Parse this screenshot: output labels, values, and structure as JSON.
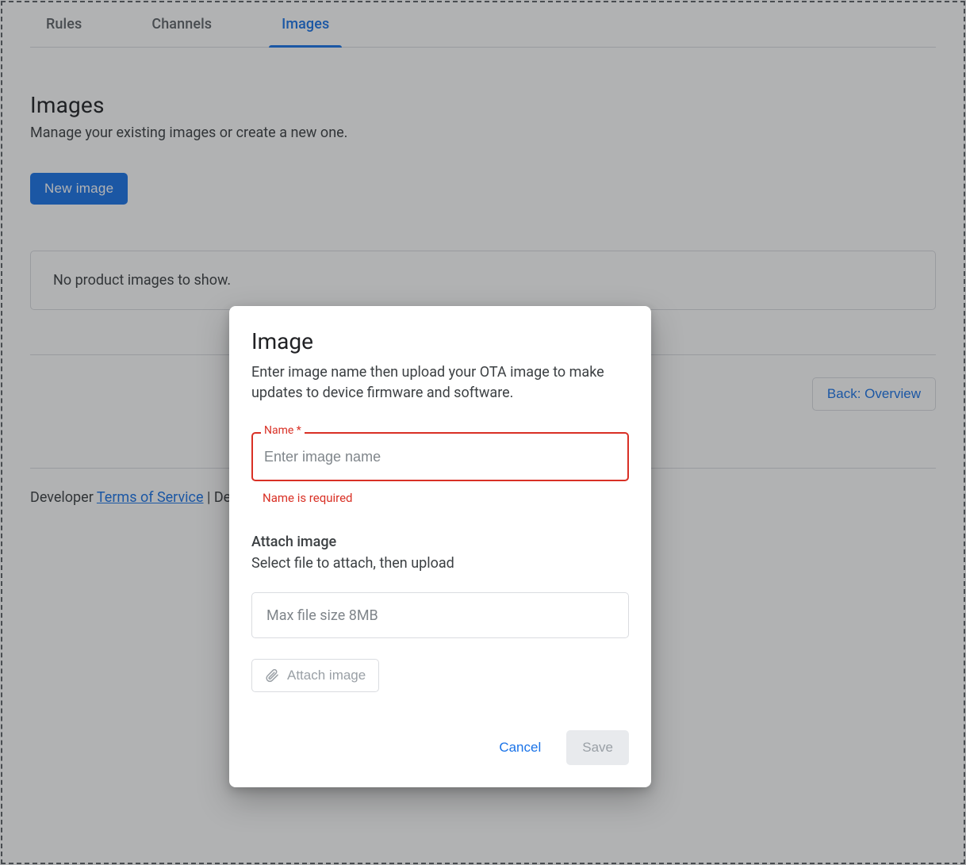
{
  "tabs": {
    "rules": "Rules",
    "channels": "Channels",
    "images": "Images"
  },
  "page": {
    "title": "Images",
    "description": "Manage your existing images or create a new one.",
    "new_image_btn": "New image",
    "empty_state": "No product images to show.",
    "back_btn": "Back: Overview"
  },
  "footer": {
    "prefix1": "Developer ",
    "tos_link": "Terms of Service",
    "rest": " | Dev"
  },
  "dialog": {
    "title": "Image",
    "description": "Enter image name then upload your OTA image to make updates to device firmware and software.",
    "name_label": "Name *",
    "name_placeholder": "Enter image name",
    "name_value": "",
    "name_error": "Name is required",
    "attach_title": "Attach image",
    "attach_desc": "Select file to attach, then upload",
    "file_placeholder": "Max file size 8MB",
    "attach_btn": "Attach image",
    "cancel": "Cancel",
    "save": "Save"
  }
}
